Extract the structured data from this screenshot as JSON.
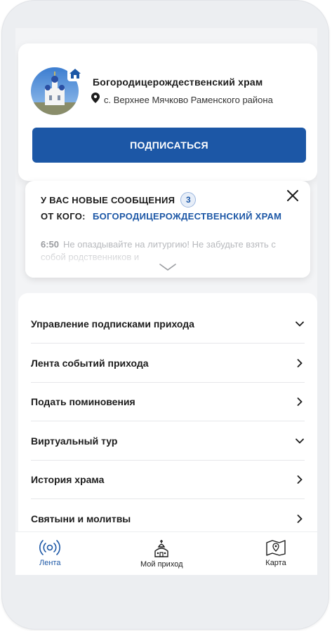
{
  "church": {
    "title": "Богородицерождественский храм",
    "location": "с. Верхнее Мячково Раменского района",
    "subscribe_label": "ПОДПИСАТЬСЯ"
  },
  "messages": {
    "header": "У ВАС НОВЫЕ СООБЩЕНИЯ",
    "count": "3",
    "from_label": "ОТ КОГО:",
    "from_name": "БОГОРОДИЦЕРОЖДЕСТВЕНСКИЙ ХРАМ",
    "time": "6:50",
    "text": "Не опаздывайте на литургию! Не забудьте взять с собой родственников и"
  },
  "menu": {
    "items": [
      {
        "label": "Управление подписками прихода",
        "icon": "chevron-down-icon"
      },
      {
        "label": "Лента событий прихода",
        "icon": "chevron-right-icon"
      },
      {
        "label": "Подать поминовения",
        "icon": "chevron-right-icon"
      },
      {
        "label": "Виртуальный тур",
        "icon": "chevron-down-icon"
      },
      {
        "label": "История храма",
        "icon": "chevron-right-icon"
      },
      {
        "label": "Святыни и молитвы",
        "icon": "chevron-right-icon"
      }
    ]
  },
  "nav": {
    "feed": "Лента",
    "my_parish": "Мой приход",
    "map": "Карта",
    "active": "feed"
  },
  "colors": {
    "accent": "#1c57a6",
    "text": "#1c1c1c"
  }
}
